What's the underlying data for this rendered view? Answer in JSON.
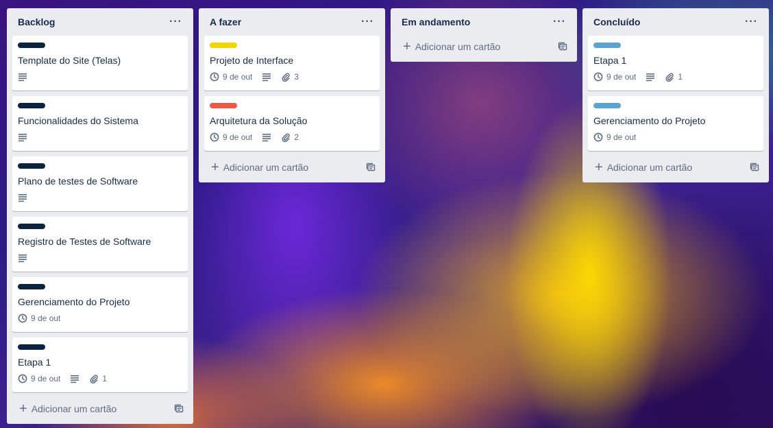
{
  "colors": {
    "label_navy": "#0c2340",
    "label_yellow": "#f2d600",
    "label_red": "#eb5a46",
    "label_blue": "#5ba4cf"
  },
  "add_card_label": "Adicionar um cartão",
  "lists": [
    {
      "title": "Backlog",
      "cards": [
        {
          "title": "Template do Site (Telas)",
          "label_color": "#0c2340",
          "due": null,
          "description": true,
          "attachments": null
        },
        {
          "title": "Funcionalidades do Sistema",
          "label_color": "#0c2340",
          "due": null,
          "description": true,
          "attachments": null
        },
        {
          "title": "Plano de testes de Software",
          "label_color": "#0c2340",
          "due": null,
          "description": true,
          "attachments": null
        },
        {
          "title": "Registro de Testes de Software",
          "label_color": "#0c2340",
          "due": null,
          "description": true,
          "attachments": null
        },
        {
          "title": "Gerenciamento do Projeto",
          "label_color": "#0c2340",
          "due": "9 de out",
          "description": false,
          "attachments": null
        },
        {
          "title": "Etapa 1",
          "label_color": "#0c2340",
          "due": "9 de out",
          "description": true,
          "attachments": "1"
        }
      ]
    },
    {
      "title": "A fazer",
      "cards": [
        {
          "title": "Projeto de Interface",
          "label_color": "#f2d600",
          "due": "9 de out",
          "description": true,
          "attachments": "3"
        },
        {
          "title": "Arquitetura da Solução",
          "label_color": "#eb5a46",
          "due": "9 de out",
          "description": true,
          "attachments": "2"
        }
      ]
    },
    {
      "title": "Em andamento",
      "cards": []
    },
    {
      "title": "Concluído",
      "cards": [
        {
          "title": "Etapa 1",
          "label_color": "#5ba4cf",
          "due": "9 de out",
          "description": true,
          "attachments": "1"
        },
        {
          "title": "Gerenciamento do Projeto",
          "label_color": "#5ba4cf",
          "due": "9 de out",
          "description": false,
          "attachments": null
        }
      ]
    }
  ]
}
